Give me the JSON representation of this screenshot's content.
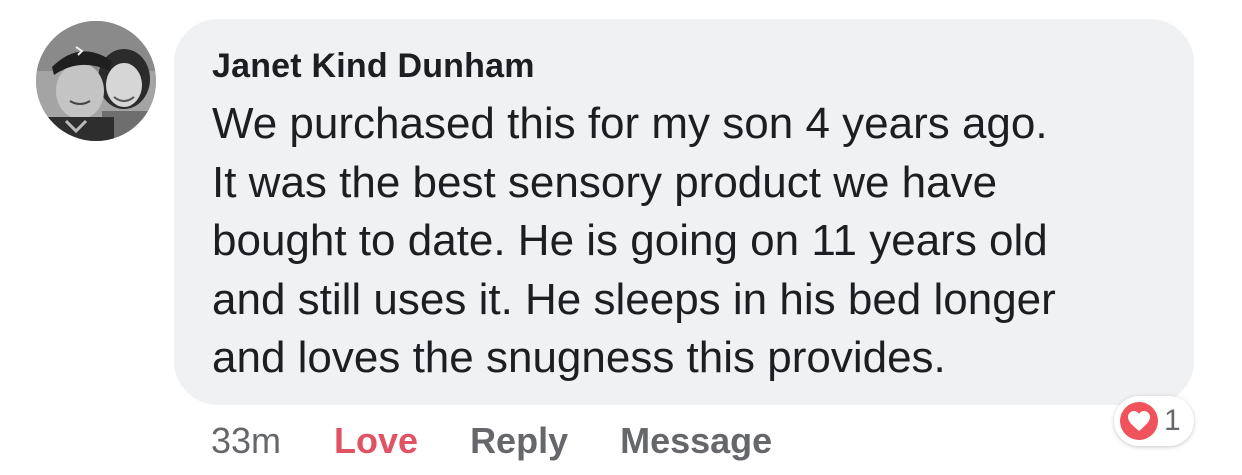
{
  "comment": {
    "author": "Janet Kind Dunham",
    "text": "We purchased this for my son 4 years ago.\nIt was the best sensory product we have\nbought to date. He is going on 11 years old\nand still uses it.  He sleeps in his bed longer\nand loves the snugness this provides.",
    "timestamp": "33m",
    "reaction_count": "1",
    "reaction_icon": "heart-icon"
  },
  "actions": {
    "love_label": "Love",
    "reply_label": "Reply",
    "message_label": "Message"
  },
  "colors": {
    "bubble_bg": "#f0f1f3",
    "love_active": "#e05264",
    "meta_gray": "#65676b",
    "heart_badge": "#f0535c"
  }
}
